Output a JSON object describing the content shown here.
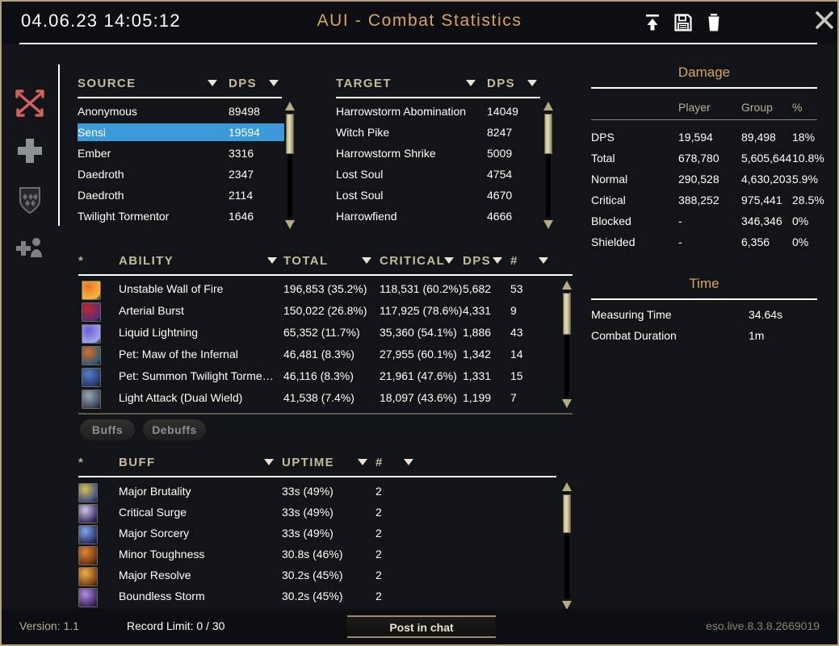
{
  "window": {
    "clock": "04.06.23 14:05:12",
    "title": "AUI - Combat Statistics",
    "icons": {
      "export": "upload-icon",
      "save": "save-floppy-icon",
      "delete": "trash-icon",
      "close": "close-icon"
    }
  },
  "sidebar": {
    "items": [
      {
        "name": "damage",
        "label": "Damage",
        "active": true,
        "color": "#d4605f"
      },
      {
        "name": "healing",
        "label": "Healing",
        "active": false,
        "color": "#8d9095"
      },
      {
        "name": "defense",
        "label": "Defense",
        "active": false,
        "color": "#6a6c71"
      },
      {
        "name": "group",
        "label": "Group",
        "active": false,
        "color": "#7e8186"
      }
    ]
  },
  "source_panel": {
    "headers": {
      "name": "SOURCE",
      "value": "DPS"
    },
    "rows": [
      {
        "name": "Anonymous",
        "dps": "89498",
        "selected": false
      },
      {
        "name": "Sensi",
        "dps": "19594",
        "selected": true
      },
      {
        "name": "Ember",
        "dps": "3316",
        "selected": false
      },
      {
        "name": "Daedroth",
        "dps": "2347",
        "selected": false
      },
      {
        "name": "Daedroth",
        "dps": "2114",
        "selected": false
      },
      {
        "name": "Twilight Tormentor",
        "dps": "1646",
        "selected": false
      }
    ]
  },
  "target_panel": {
    "headers": {
      "name": "TARGET",
      "value": "DPS"
    },
    "rows": [
      {
        "name": "Harrowstorm Abomination",
        "dps": "14049"
      },
      {
        "name": "Witch Pike",
        "dps": "8247"
      },
      {
        "name": "Harrowstorm Shrike",
        "dps": "5009"
      },
      {
        "name": "Lost Soul",
        "dps": "4754"
      },
      {
        "name": "Lost Soul",
        "dps": "4670"
      },
      {
        "name": "Harrowfiend",
        "dps": "4666"
      }
    ]
  },
  "ability_table": {
    "headers": [
      "*",
      "ABILITY",
      "TOTAL",
      "CRITICAL",
      "DPS",
      "#"
    ],
    "rows": [
      {
        "icon": "unstable-wall-of-fire-icon",
        "c1": "#e87428",
        "c2": "#f5b942",
        "ability": "Unstable Wall of Fire",
        "total": "196,853 (35.2%)",
        "critical": "118,531 (60.2%)",
        "dps": "5,682",
        "count": "53"
      },
      {
        "icon": "arterial-burst-icon",
        "c1": "#c0282e",
        "c2": "#5a2b7a",
        "ability": "Arterial Burst",
        "total": "150,022 (26.8%)",
        "critical": "117,925 (78.6%)",
        "dps": "4,331",
        "count": "9"
      },
      {
        "icon": "liquid-lightning-icon",
        "c1": "#6f5fd0",
        "c2": "#9fa8f0",
        "ability": "Liquid Lightning",
        "total": "65,352 (11.7%)",
        "critical": "35,360 (54.1%)",
        "dps": "1,886",
        "count": "43"
      },
      {
        "icon": "maw-of-the-infernal-icon",
        "c1": "#e06a1e",
        "c2": "#2c5a78",
        "ability": "Pet: Maw of the Infernal",
        "total": "46,481 (8.3%)",
        "critical": "27,955 (60.1%)",
        "dps": "1,342",
        "count": "14"
      },
      {
        "icon": "summon-twilight-tormentor-icon",
        "c1": "#4f7ec8",
        "c2": "#2a3a66",
        "ability": "Pet: Summon Twilight Torme…",
        "total": "46,116 (8.3%)",
        "critical": "21,961 (47.6%)",
        "dps": "1,331",
        "count": "15"
      },
      {
        "icon": "light-attack-dual-wield-icon",
        "c1": "#9aa5b5",
        "c2": "#3b4757",
        "ability": "Light Attack (Dual Wield)",
        "total": "41,538 (7.4%)",
        "critical": "18,097 (43.6%)",
        "dps": "1,199",
        "count": "7"
      }
    ]
  },
  "effect_tabs": [
    {
      "label": "Buffs",
      "active": true
    },
    {
      "label": "Debuffs",
      "active": false
    }
  ],
  "buff_table": {
    "headers": [
      "*",
      "BUFF",
      "UPTIME",
      "#"
    ],
    "rows": [
      {
        "icon": "major-brutality-icon",
        "c1": "#d9c24a",
        "c2": "#3b4c8a",
        "buff": "Major Brutality",
        "uptime": "33s (49%)",
        "count": "2"
      },
      {
        "icon": "critical-surge-icon",
        "c1": "#cfc9e8",
        "c2": "#3a2b5e",
        "buff": "Critical Surge",
        "uptime": "33s (49%)",
        "count": "2"
      },
      {
        "icon": "major-sorcery-icon",
        "c1": "#7ea8e8",
        "c2": "#2a2f63",
        "buff": "Major Sorcery",
        "uptime": "33s (49%)",
        "count": "2"
      },
      {
        "icon": "minor-toughness-icon",
        "c1": "#e08a30",
        "c2": "#6d2f12",
        "buff": "Minor Toughness",
        "uptime": "30.8s (46%)",
        "count": "2"
      },
      {
        "icon": "major-resolve-icon",
        "c1": "#f0b24a",
        "c2": "#7a3c10",
        "buff": "Major Resolve",
        "uptime": "30.2s (45%)",
        "count": "2"
      },
      {
        "icon": "boundless-storm-icon",
        "c1": "#b98de0",
        "c2": "#3a2460",
        "buff": "Boundless Storm",
        "uptime": "30.2s (45%)",
        "count": "2"
      }
    ]
  },
  "damage_panel": {
    "title": "Damage",
    "columns": [
      "Player",
      "Group",
      "%"
    ],
    "rows": [
      {
        "label": "DPS",
        "player": "19,594",
        "group": "89,498",
        "pct": "18%"
      },
      {
        "label": "Total",
        "player": "678,780",
        "group": "5,605,644",
        "pct": "10.8%"
      },
      {
        "label": "Normal",
        "player": "290,528",
        "group": "4,630,203",
        "pct": "5.9%"
      },
      {
        "label": "Critical",
        "player": "388,252",
        "group": "975,441",
        "pct": "28.5%"
      },
      {
        "label": "Blocked",
        "player": "-",
        "group": "346,346",
        "pct": "0%"
      },
      {
        "label": "Shielded",
        "player": "-",
        "group": "6,356",
        "pct": "0%"
      }
    ]
  },
  "time_panel": {
    "title": "Time",
    "rows": [
      {
        "label": "Measuring Time",
        "value": "34.64s"
      },
      {
        "label": "Combat Duration",
        "value": "1m"
      }
    ]
  },
  "footer": {
    "version": "Version: 1.1",
    "record_limit": "Record Limit: 0 / 30",
    "post_button": "Post in chat",
    "build": "eso.live.8.3.8.2669019"
  },
  "colors": {
    "accent_gold": "#d8a55a",
    "header_text": "#c6bb9a",
    "selection_blue": "#3b9bd8",
    "window_border": "#b2a179",
    "scrollbar_thumb": "#cfc69c"
  }
}
